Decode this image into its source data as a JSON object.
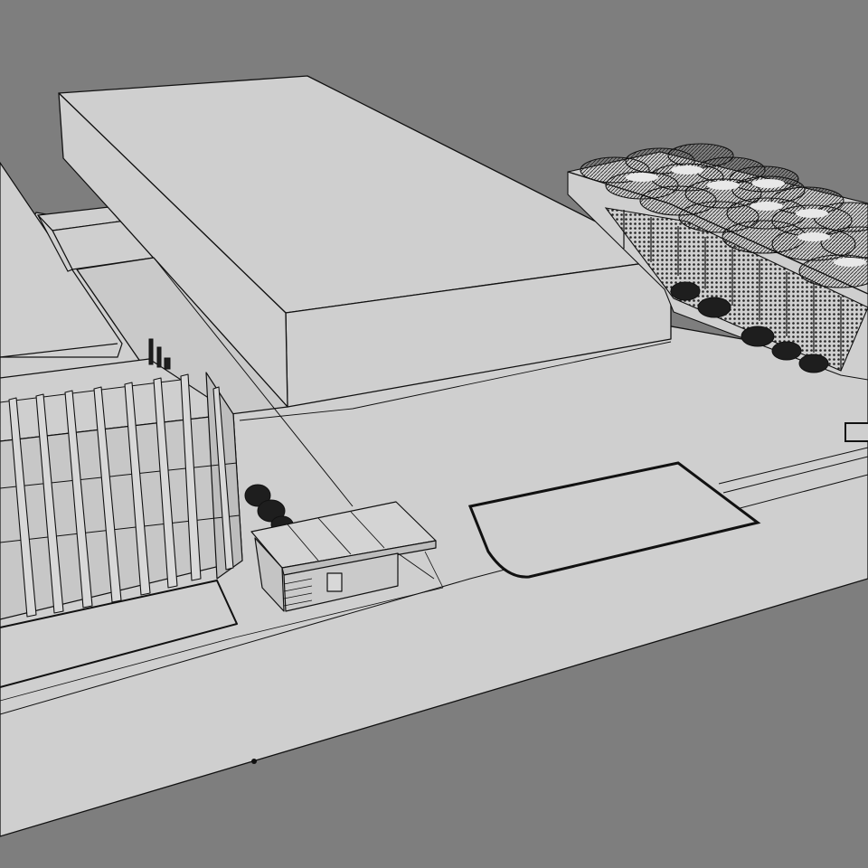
{
  "scene": {
    "type": "3d-model-viewport",
    "style": "monochrome hidden-line sketch",
    "colors": {
      "background": "#7e7e7e",
      "surface": "#cfcfcf",
      "surface_shade": "#bdbdbd",
      "edge": "#111111",
      "foliage": "#1e1e1e"
    },
    "objects": [
      "ground-plane",
      "warehouse-block",
      "glass-office-building",
      "entrance-canopy-pavilion",
      "vaulted-roof-building",
      "parking-island",
      "trees",
      "utility-stacks"
    ]
  }
}
